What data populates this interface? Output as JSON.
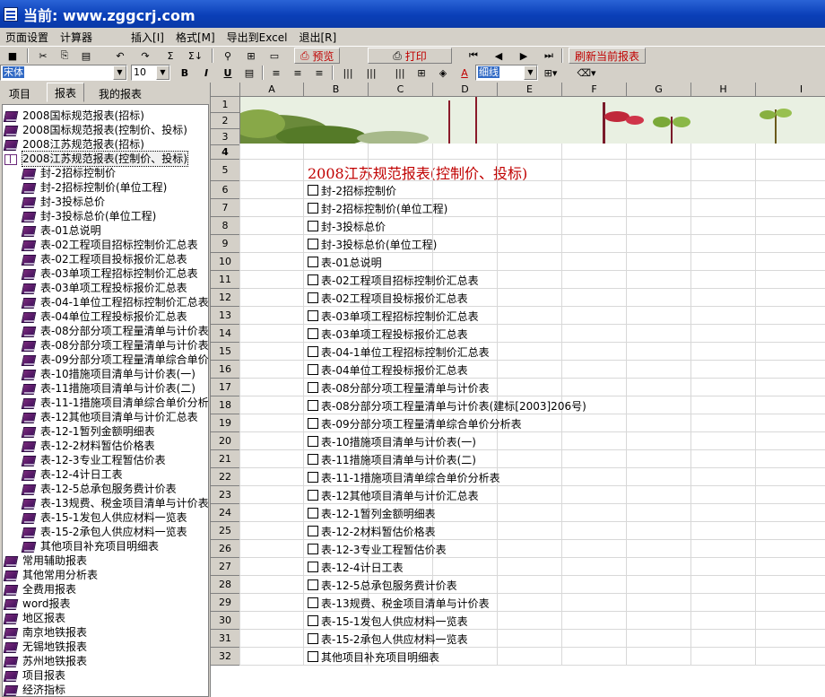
{
  "app": {
    "title": "当前: www.zggcrj.com"
  },
  "menu": [
    "页面设置",
    "计算器",
    "插入[I]",
    "格式[M]",
    "导出到Excel",
    "退出[R]"
  ],
  "toolbar": {
    "preview_label": "预览",
    "print_label": "打印",
    "refresh_label": "刷新当前报表",
    "font_name": "宋体",
    "font_size": "10",
    "border_style": "细线"
  },
  "tabs": [
    "项目",
    "报表",
    "我的报表"
  ],
  "tree": {
    "top": [
      "2008国标规范报表(招标)",
      "2008国标规范报表(控制价、投标)",
      "2008江苏规范报表(招标)",
      "2008江苏规范报表(控制价、投标)"
    ],
    "children": [
      "封-2招标控制价",
      "封-2招标控制价(单位工程)",
      "封-3投标总价",
      "封-3投标总价(单位工程)",
      "表-01总说明",
      "表-02工程项目招标控制价汇总表",
      "表-02工程项目投标报价汇总表",
      "表-03单项工程招标控制价汇总表",
      "表-03单项工程投标报价汇总表",
      "表-04-1单位工程招标控制价汇总表",
      "表-04单位工程投标报价汇总表",
      "表-08分部分项工程量清单与计价表",
      "表-08分部分项工程量清单与计价表",
      "表-09分部分项工程量清单综合单价",
      "表-10措施项目清单与计价表(一)",
      "表-11措施项目清单与计价表(二)",
      "表-11-1措施项目清单综合单价分析",
      "表-12其他项目清单与计价汇总表",
      "表-12-1暂列金额明细表",
      "表-12-2材料暂估价格表",
      "表-12-3专业工程暂估价表",
      "表-12-4计日工表",
      "表-12-5总承包服务费计价表",
      "表-13规费、税金项目清单与计价表",
      "表-15-1发包人供应材料一览表",
      "表-15-2承包人供应材料一览表",
      "其他项目补充项目明细表"
    ],
    "bottom": [
      "常用辅助报表",
      "其他常用分析表",
      "全费用报表",
      "word报表",
      "地区报表",
      "南京地铁报表",
      "无锡地铁报表",
      "苏州地铁报表",
      "项目报表",
      "经济指标"
    ]
  },
  "sheet": {
    "columns": [
      "A",
      "B",
      "C",
      "D",
      "E",
      "F",
      "G",
      "H",
      "I"
    ],
    "rows": [
      "1",
      "2",
      "3",
      "4",
      "5",
      "6",
      "7",
      "8",
      "9",
      "10",
      "11",
      "12",
      "13",
      "14",
      "15",
      "16",
      "17",
      "18",
      "19",
      "20",
      "21",
      "22",
      "23",
      "24",
      "25",
      "26",
      "27",
      "28",
      "29",
      "30",
      "31",
      "32"
    ],
    "title": "2008江苏规范报表(控制价、投标)",
    "items": [
      "封-2招标控制价",
      "封-2招标控制价(单位工程)",
      "封-3投标总价",
      "封-3投标总价(单位工程)",
      "表-01总说明",
      "表-02工程项目招标控制价汇总表",
      "表-02工程项目投标报价汇总表",
      "表-03单项工程招标控制价汇总表",
      "表-03单项工程投标报价汇总表",
      "表-04-1单位工程招标控制价汇总表",
      "表-04单位工程投标报价汇总表",
      "表-08分部分项工程量清单与计价表",
      "表-08分部分项工程量清单与计价表(建标[2003]206号)",
      "表-09分部分项工程量清单综合单价分析表",
      "表-10措施项目清单与计价表(一)",
      "表-11措施项目清单与计价表(二)",
      "表-11-1措施项目清单综合单价分析表",
      "表-12其他项目清单与计价汇总表",
      "表-12-1暂列金额明细表",
      "表-12-2材料暂估价格表",
      "表-12-3专业工程暂估价表",
      "表-12-4计日工表",
      "表-12-5总承包服务费计价表",
      "表-13规费、税金项目清单与计价表",
      "表-15-1发包人供应材料一览表",
      "表-15-2承包人供应材料一览表",
      "其他项目补充项目明细表"
    ]
  },
  "colors": {
    "title_bar": "#0a3fb8",
    "accent_red": "#c00000",
    "chrome": "#d4d0c8",
    "tree_book": "#5a1a6e"
  }
}
